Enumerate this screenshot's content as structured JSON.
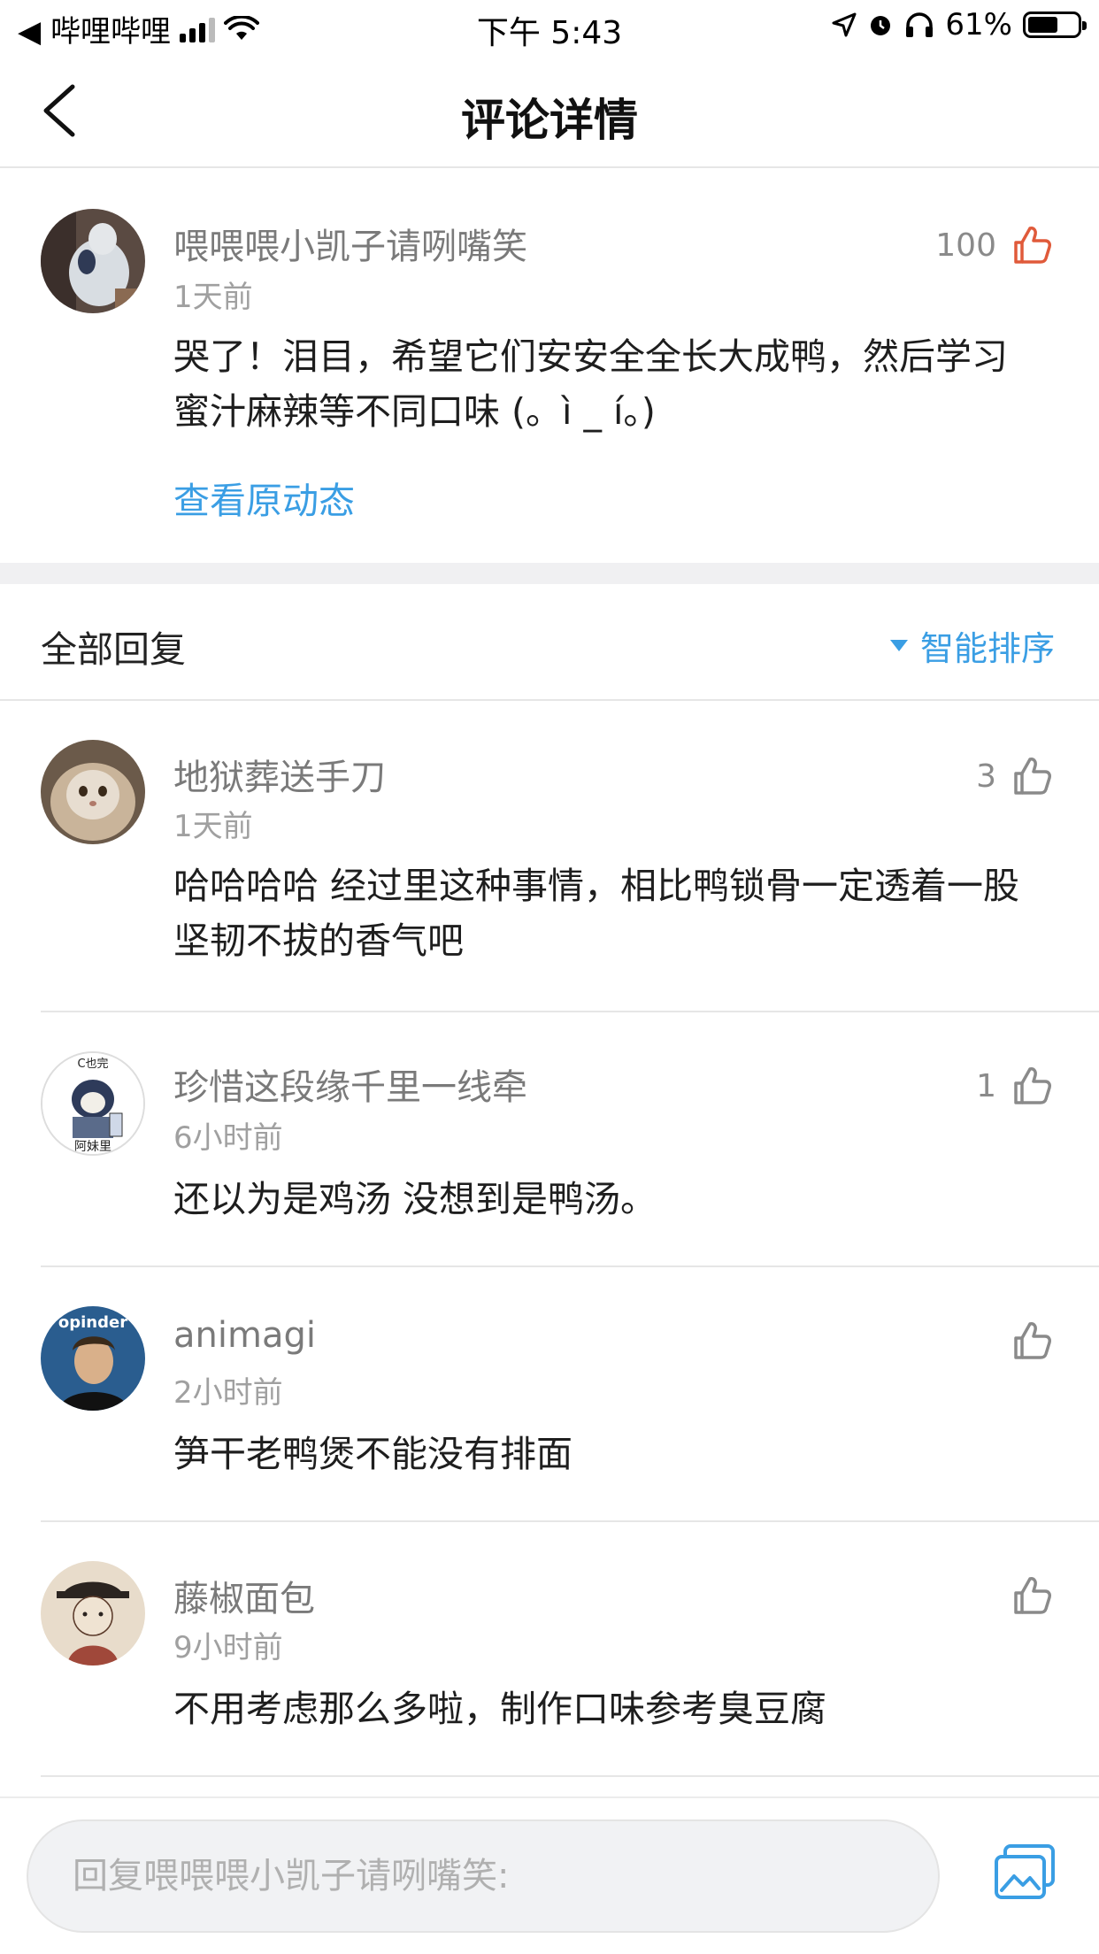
{
  "status_bar": {
    "back_app": "◀ 哔哩哔哩",
    "time": "下午 5:43",
    "battery": "61%"
  },
  "nav": {
    "title": "评论详情"
  },
  "main_comment": {
    "username": "喂喂喂小凯子请咧嘴笑",
    "time": "1天前",
    "text_line1": "哭了！泪目，希望它们安安全全长大成鸭，然后学习",
    "text_line2": "蜜汁麻辣等不同口味 (。ì _ í。)",
    "likes": "100",
    "view_original": "查看原动态",
    "accent": "#e05a3a"
  },
  "replies_header": {
    "title": "全部回复",
    "sort_label": "智能排序"
  },
  "replies": [
    {
      "username": "地狱葬送手刀",
      "time": "1天前",
      "text_line1": "哈哈哈哈 经过里这种事情，相比鸭锁骨一定透着一股",
      "text_line2": "坚韧不拔的香气吧",
      "likes": "3"
    },
    {
      "username": "珍惜这段缘千里一线牵",
      "time": "6小时前",
      "text_line1": "还以为是鸡汤  没想到是鸭汤。",
      "likes": "1",
      "avatar_text_top": "C也完",
      "avatar_text_bottom": "阿妹里"
    },
    {
      "username": "animagi",
      "time": "2小时前",
      "text_line1": "笋干老鸭煲不能没有排面",
      "likes": "",
      "avatar_text": "opinder"
    },
    {
      "username": "藤椒面包",
      "time": "9小时前",
      "text_line1": "不用考虑那么多啦，制作口味参考臭豆腐",
      "likes": ""
    }
  ],
  "bottom_bar": {
    "placeholder": "回复喂喂喂小凯子请咧嘴笑:"
  },
  "colors": {
    "link_blue": "#3a9ee4",
    "like_red": "#e05a3a",
    "icon_gray": "#8a8a8a"
  }
}
